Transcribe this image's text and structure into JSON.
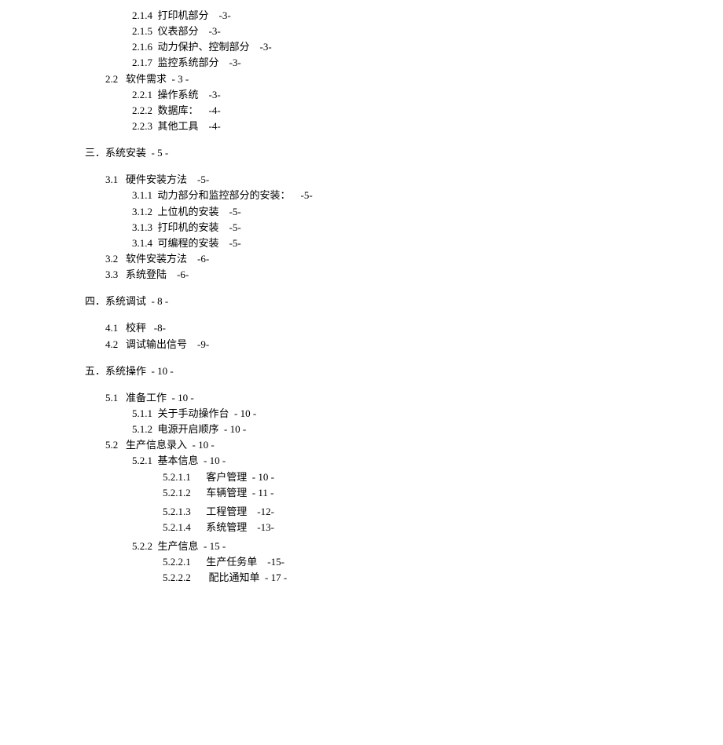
{
  "lines": [
    {
      "cls": "l3",
      "text": "2.1.4  打印机部分    -3-"
    },
    {
      "cls": "l3",
      "text": "2.1.5  仪表部分    -3-"
    },
    {
      "cls": "l3",
      "text": "2.1.6  动力保护、控制部分    -3-"
    },
    {
      "cls": "l3",
      "text": "2.1.7  监控系统部分    -3-"
    },
    {
      "cls": "l2",
      "text": "2.2   软件需求  - 3 -"
    },
    {
      "cls": "l3",
      "text": "2.2.1  操作系统    -3-"
    },
    {
      "cls": "l3",
      "text": "2.2.2  数据库：    -4-"
    },
    {
      "cls": "l3",
      "text": "2.2.3  其他工具    -4-"
    },
    {
      "cls": "l1 section-gap",
      "text": "三．系统安装  - 5 -"
    },
    {
      "cls": "l2 section-gap",
      "text": "3.1   硬件安装方法    -5-"
    },
    {
      "cls": "l3",
      "text": "3.1.1  动力部分和监控部分的安装：    -5-"
    },
    {
      "cls": "l3",
      "text": "3.1.2  上位机的安装    -5-"
    },
    {
      "cls": "l3",
      "text": "3.1.3  打印机的安装    -5-"
    },
    {
      "cls": "l3",
      "text": "3.1.4  可编程的安装    -5-"
    },
    {
      "cls": "l2",
      "text": "3.2   软件安装方法    -6-"
    },
    {
      "cls": "l2",
      "text": "3.3   系统登陆    -6-"
    },
    {
      "cls": "l1 section-gap",
      "text": "四．系统调试  - 8 -"
    },
    {
      "cls": "l2 section-gap",
      "text": "4.1   校秤   -8-"
    },
    {
      "cls": "l2",
      "text": "4.2   调试输出信号    -9-"
    },
    {
      "cls": "l1 section-gap",
      "text": "五．系统操作  - 10 -"
    },
    {
      "cls": "l2 section-gap",
      "text": "5.1   准备工作  - 10 -"
    },
    {
      "cls": "l3",
      "text": "5.1.1  关于手动操作台  - 10 -"
    },
    {
      "cls": "l3",
      "text": "5.1.2  电源开启顺序  - 10 -"
    },
    {
      "cls": "l2",
      "text": "5.2   生产信息录入  - 10 -"
    },
    {
      "cls": "l3",
      "text": "5.2.1  基本信息  - 10 -"
    },
    {
      "cls": "l4",
      "text": "5.2.1.1      客户管理  - 10 -"
    },
    {
      "cls": "l4",
      "text": "5.2.1.2      车辆管理  - 11 -"
    },
    {
      "cls": "l4 small-gap",
      "text": "5.2.1.3      工程管理    -12-"
    },
    {
      "cls": "l4",
      "text": "5.2.1.4      系统管理    -13-"
    },
    {
      "cls": "l3 small-gap",
      "text": "5.2.2  生产信息  - 15 -"
    },
    {
      "cls": "l4",
      "text": "5.2.2.1      生产任务单    -15-"
    },
    {
      "cls": "l4",
      "text": "5.2.2.2       配比通知单  - 17 -"
    }
  ]
}
